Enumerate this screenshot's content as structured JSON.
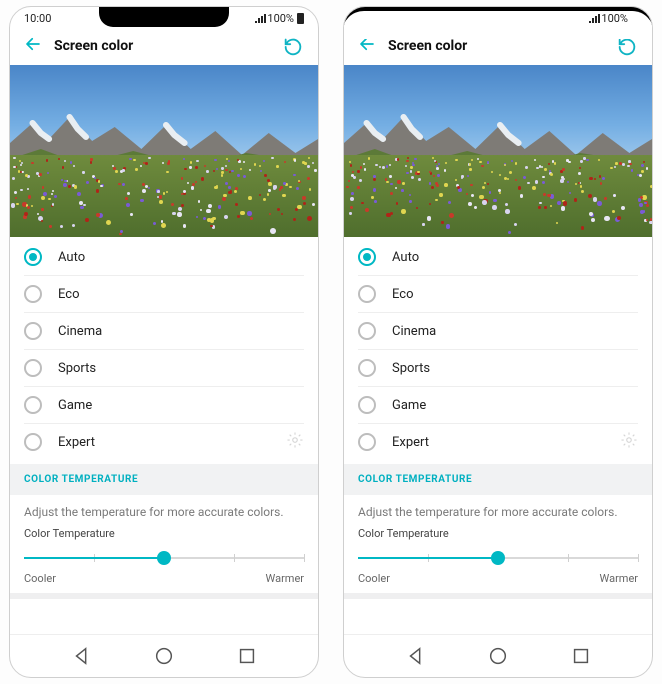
{
  "status": {
    "time": "10:00",
    "battery_pct": "100%"
  },
  "header": {
    "title": "Screen color"
  },
  "modes": {
    "selected_index": 0,
    "items": [
      {
        "label": "Auto"
      },
      {
        "label": "Eco"
      },
      {
        "label": "Cinema"
      },
      {
        "label": "Sports"
      },
      {
        "label": "Game"
      },
      {
        "label": "Expert",
        "has_settings": true
      }
    ]
  },
  "section": {
    "title": "COLOR TEMPERATURE",
    "desc": "Adjust the temperature for more accurate colors.",
    "slider_label": "Color Temperature",
    "min_label": "Cooler",
    "max_label": "Warmer",
    "value_pct": 50
  },
  "accent": "#00b8c4"
}
